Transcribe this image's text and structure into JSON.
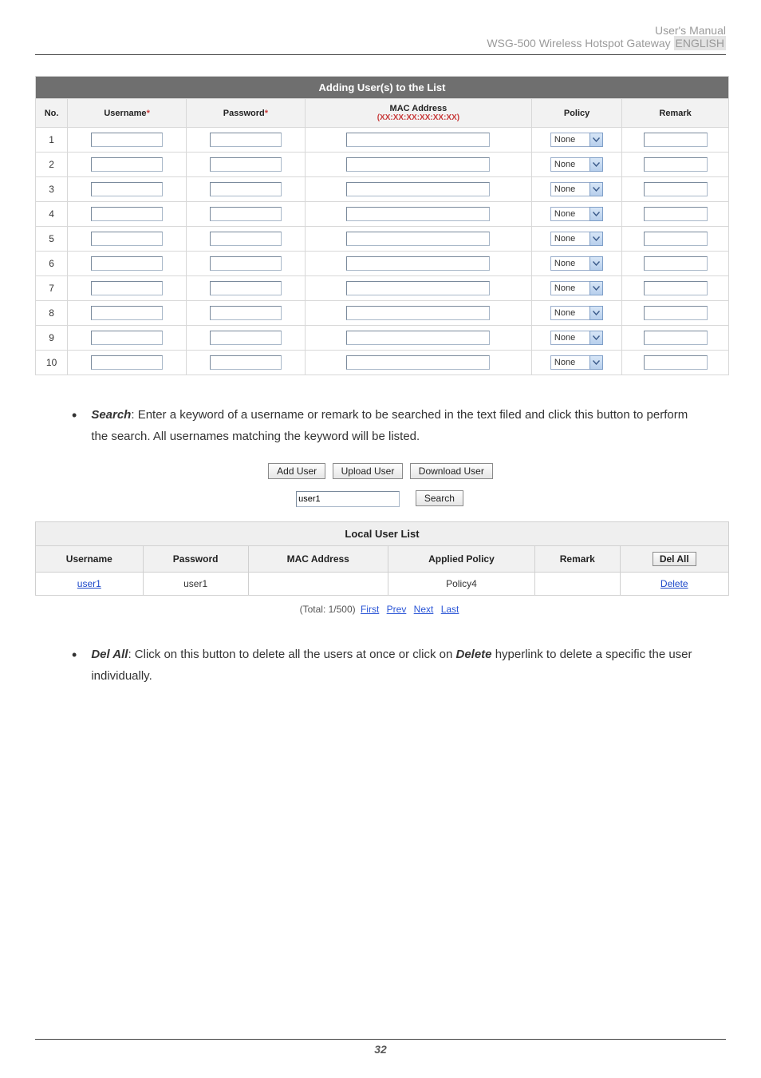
{
  "header": {
    "line1": "User's Manual",
    "line2_a": "WSG-500 Wireless Hotspot Gateway ",
    "line2_eng": "ENGLISH"
  },
  "table1": {
    "title": "Adding User(s) to the List",
    "cols": {
      "no": "No.",
      "username": "Username",
      "password": "Password",
      "mac": "MAC Address",
      "mac_sub": "(XX:XX:XX:XX:XX:XX)",
      "policy": "Policy",
      "remark": "Remark"
    },
    "rows": [
      {
        "no": "1",
        "username": "",
        "password": "",
        "mac": "",
        "policy": "None",
        "remark": ""
      },
      {
        "no": "2",
        "username": "",
        "password": "",
        "mac": "",
        "policy": "None",
        "remark": ""
      },
      {
        "no": "3",
        "username": "",
        "password": "",
        "mac": "",
        "policy": "None",
        "remark": ""
      },
      {
        "no": "4",
        "username": "",
        "password": "",
        "mac": "",
        "policy": "None",
        "remark": ""
      },
      {
        "no": "5",
        "username": "",
        "password": "",
        "mac": "",
        "policy": "None",
        "remark": ""
      },
      {
        "no": "6",
        "username": "",
        "password": "",
        "mac": "",
        "policy": "None",
        "remark": ""
      },
      {
        "no": "7",
        "username": "",
        "password": "",
        "mac": "",
        "policy": "None",
        "remark": ""
      },
      {
        "no": "8",
        "username": "",
        "password": "",
        "mac": "",
        "policy": "None",
        "remark": ""
      },
      {
        "no": "9",
        "username": "",
        "password": "",
        "mac": "",
        "policy": "None",
        "remark": ""
      },
      {
        "no": "10",
        "username": "",
        "password": "",
        "mac": "",
        "policy": "None",
        "remark": ""
      }
    ]
  },
  "search_para": {
    "label": "Search",
    "text": ": Enter a keyword of a username or remark to be searched in the text filed and click this button to perform the search. All usernames matching the keyword will be listed."
  },
  "buttons": {
    "add": "Add User",
    "upload": "Upload User",
    "download": "Download User",
    "search": "Search",
    "delall": "Del All"
  },
  "search_value": "user1",
  "table2": {
    "title": "Local User List",
    "cols": {
      "username": "Username",
      "password": "Password",
      "mac": "MAC Address",
      "policy": "Applied Policy",
      "remark": "Remark"
    },
    "rows": [
      {
        "username": "user1",
        "password": "user1",
        "mac": "",
        "policy": "Policy4",
        "remark": "",
        "action": "Delete"
      }
    ]
  },
  "totals": {
    "text": "(Total: 1/500) ",
    "first": "First",
    "prev": "Prev",
    "next": "Next",
    "last": "Last"
  },
  "delall_para": {
    "label": "Del All",
    "mid1": ": Click on this button to delete all the users at once or click on ",
    "delete_word": "Delete",
    "mid2": " hyperlink to delete a specific the user individually."
  },
  "footer": {
    "page": "32"
  }
}
